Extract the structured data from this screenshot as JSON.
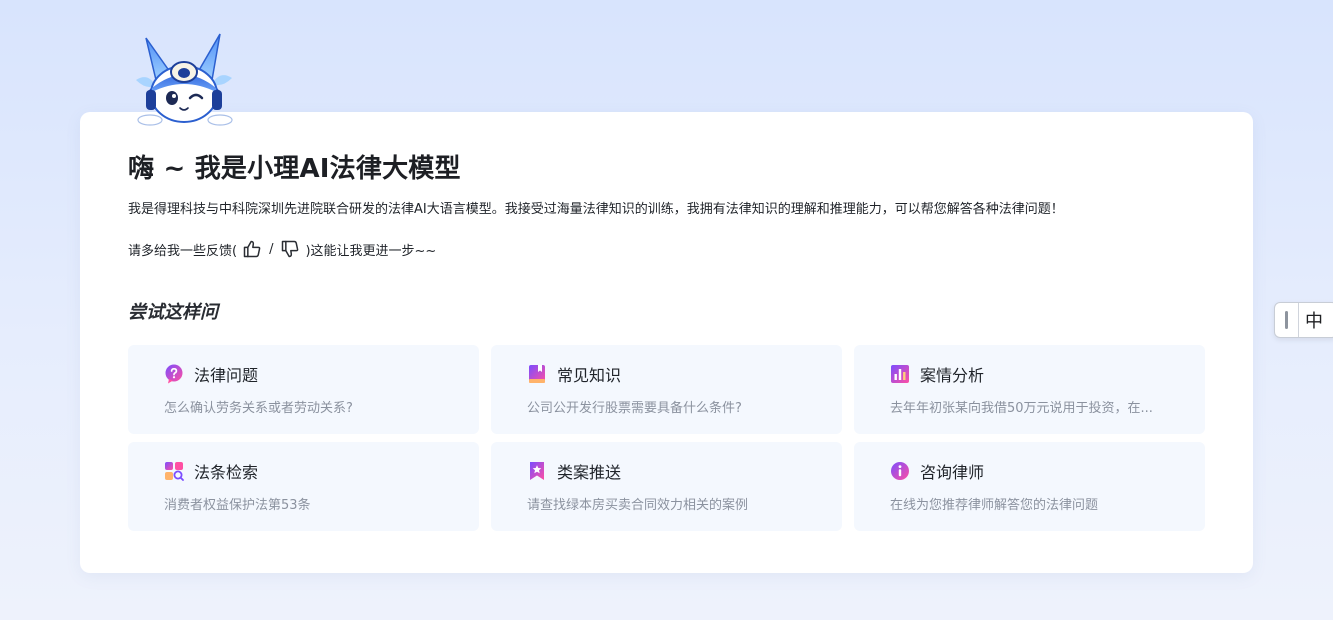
{
  "intro": {
    "title": "嗨 ~ 我是小理AI法律大模型",
    "description": "我是得理科技与中科院深圳先进院联合研发的法律AI大语言模型。我接受过海量法律知识的训练，我拥有法律知识的理解和推理能力，可以帮您解答各种法律问题！",
    "feedback_prefix": "请多给我一些反馈(",
    "feedback_separator": "/",
    "feedback_suffix": ")这能让我更进一步~~"
  },
  "suggestions": {
    "heading": "尝试这样问",
    "items": [
      {
        "title": "法律问题",
        "question": "怎么确认劳务关系或者劳动关系?",
        "icon": "question-bubble-icon"
      },
      {
        "title": "常见知识",
        "question": "公司公开发行股票需要具备什么条件?",
        "icon": "book-icon"
      },
      {
        "title": "案情分析",
        "question": "去年年初张某向我借50万元说用于投资，在...",
        "icon": "bar-chart-icon"
      },
      {
        "title": "法条检索",
        "question": "消费者权益保护法第53条",
        "icon": "search-grid-icon"
      },
      {
        "title": "类案推送",
        "question": "请查找绿本房买卖合同效力相关的案例",
        "icon": "bookmark-star-icon"
      },
      {
        "title": "咨询律师",
        "question": "在线为您推荐律师解答您的法律问题",
        "icon": "info-icon"
      }
    ]
  },
  "ime": {
    "label": "中"
  },
  "colors": {
    "accent_purple": "#7b4dff",
    "accent_pink": "#ff4fa3",
    "tile_background": "#f4f8fe"
  }
}
